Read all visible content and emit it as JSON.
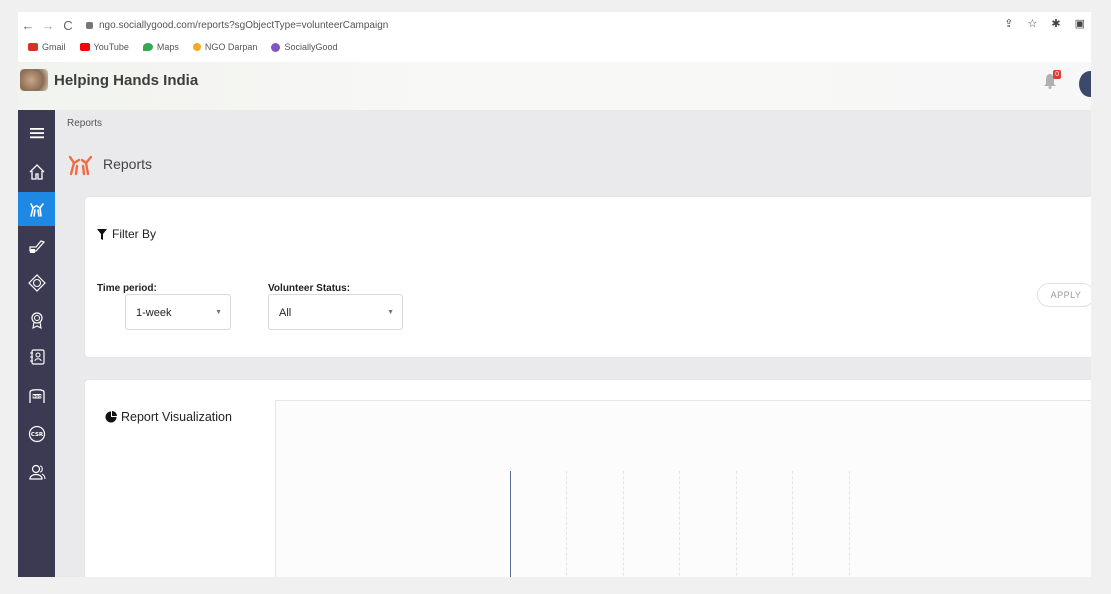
{
  "browser": {
    "back": "←",
    "forward": "→",
    "reload": "C",
    "url": "ngo.sociallygood.com/reports?sgObjectType=volunteerCampaign",
    "bookmarks": [
      {
        "label": "Gmail",
        "color": "#d93025"
      },
      {
        "label": "YouTube",
        "color": "#ff0000"
      },
      {
        "label": "Maps",
        "color": "#34a853"
      },
      {
        "label": "NGO Darpan",
        "color": "#f9a825"
      },
      {
        "label": "SociallyGood",
        "color": "#7e57c2"
      }
    ]
  },
  "header": {
    "title": "Helping Hands India",
    "notification_count": "0"
  },
  "sidebar": {
    "items": [
      {
        "name": "menu-icon"
      },
      {
        "name": "home-icon"
      },
      {
        "name": "volunteer-hands-icon",
        "active": true
      },
      {
        "name": "donation-icon"
      },
      {
        "name": "badge-icon"
      },
      {
        "name": "award-icon"
      },
      {
        "name": "contacts-icon"
      },
      {
        "name": "ngo-icon"
      },
      {
        "name": "csr-icon"
      },
      {
        "name": "users-icon"
      }
    ],
    "active_color": "#1e88e5",
    "bg_color": "#3b3a52"
  },
  "page": {
    "breadcrumb": "Reports",
    "title": "Reports"
  },
  "filter": {
    "heading": "Filter By",
    "time_period": {
      "label": "Time period:",
      "value": "1-week"
    },
    "volunteer_status": {
      "label": "Volunteer Status:",
      "value": "All"
    },
    "apply": "APPLY"
  },
  "viz": {
    "heading": "Report Visualization"
  }
}
